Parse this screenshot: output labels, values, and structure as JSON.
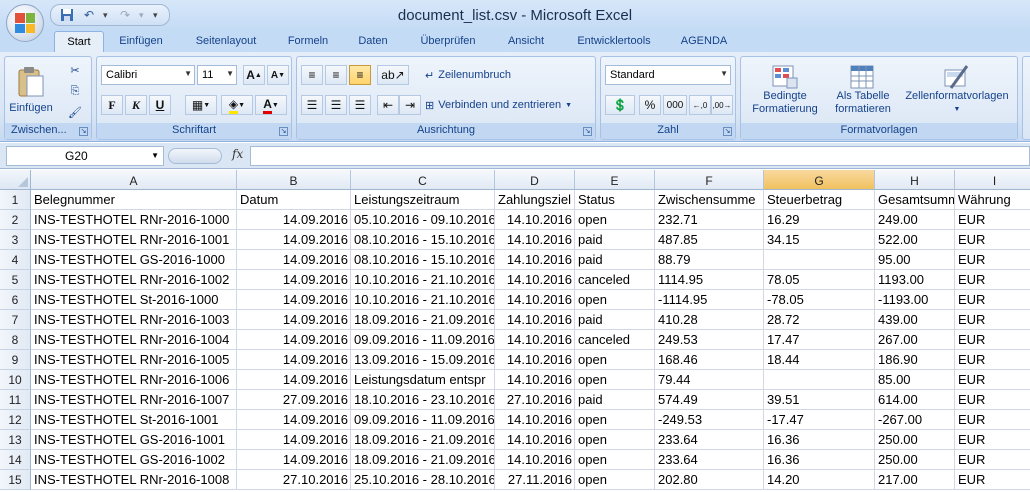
{
  "window": {
    "title": "document_list.csv - Microsoft Excel"
  },
  "tabs": [
    "Start",
    "Einfügen",
    "Seitenlayout",
    "Formeln",
    "Daten",
    "Überprüfen",
    "Ansicht",
    "Entwicklertools",
    "AGENDA"
  ],
  "ribbon": {
    "clipboard": {
      "paste_label": "Einfügen",
      "group_label": "Zwischen..."
    },
    "font": {
      "name": "Calibri",
      "size": "11",
      "bold": "F",
      "italic": "K",
      "underline": "U",
      "group_label": "Schriftart"
    },
    "alignment": {
      "wrap_label": "Zeilenumbruch",
      "merge_label": "Verbinden und zentrieren",
      "group_label": "Ausrichtung"
    },
    "number": {
      "format": "Standard",
      "percent": "%",
      "thousands": "000",
      "group_label": "Zahl"
    },
    "styles": {
      "conditional_line1": "Bedingte",
      "conditional_line2": "Formatierung",
      "table_line1": "Als Tabelle",
      "table_line2": "formatieren",
      "cellstyles_label": "Zellenformatvorlagen",
      "group_label": "Formatvorlagen"
    }
  },
  "formula_bar": {
    "name_box": "G20",
    "fx": "fx",
    "value": ""
  },
  "grid": {
    "columns": [
      "A",
      "B",
      "C",
      "D",
      "E",
      "F",
      "G",
      "H",
      "I"
    ],
    "selected_column": "G",
    "row_numbers": [
      "1",
      "2",
      "3",
      "4",
      "5",
      "6",
      "7",
      "8",
      "9",
      "10",
      "11",
      "12",
      "13",
      "14",
      "15"
    ],
    "rows": [
      [
        "Belegnummer",
        "Datum",
        "Leistungszeitraum",
        "Zahlungsziel",
        "Status",
        "Zwischensumme",
        "Steuerbetrag",
        "Gesamtsumme",
        "Währung"
      ],
      [
        "INS-TESTHOTEL RNr-2016-1000",
        "14.09.2016",
        "05.10.2016 - 09.10.2016",
        "14.10.2016",
        "open",
        "232.71",
        "16.29",
        "249.00",
        "EUR"
      ],
      [
        "INS-TESTHOTEL RNr-2016-1001",
        "14.09.2016",
        "08.10.2016 - 15.10.2016",
        "14.10.2016",
        "paid",
        "487.85",
        "34.15",
        "522.00",
        "EUR"
      ],
      [
        "INS-TESTHOTEL GS-2016-1000",
        "14.09.2016",
        "08.10.2016 - 15.10.2016",
        "14.10.2016",
        "paid",
        "88.79",
        "",
        "95.00",
        "EUR"
      ],
      [
        "INS-TESTHOTEL RNr-2016-1002",
        "14.09.2016",
        "10.10.2016 - 21.10.2016",
        "14.10.2016",
        "canceled",
        "1114.95",
        "78.05",
        "1193.00",
        "EUR"
      ],
      [
        "INS-TESTHOTEL St-2016-1000",
        "14.09.2016",
        "10.10.2016 - 21.10.2016",
        "14.10.2016",
        "open",
        "-1114.95",
        "-78.05",
        "-1193.00",
        "EUR"
      ],
      [
        "INS-TESTHOTEL RNr-2016-1003",
        "14.09.2016",
        "18.09.2016 - 21.09.2016",
        "14.10.2016",
        "paid",
        "410.28",
        "28.72",
        "439.00",
        "EUR"
      ],
      [
        "INS-TESTHOTEL RNr-2016-1004",
        "14.09.2016",
        "09.09.2016 - 11.09.2016",
        "14.10.2016",
        "canceled",
        "249.53",
        "17.47",
        "267.00",
        "EUR"
      ],
      [
        "INS-TESTHOTEL RNr-2016-1005",
        "14.09.2016",
        "13.09.2016 - 15.09.2016",
        "14.10.2016",
        "open",
        "168.46",
        "18.44",
        "186.90",
        "EUR"
      ],
      [
        "INS-TESTHOTEL RNr-2016-1006",
        "14.09.2016",
        "Leistungsdatum entspr",
        "14.10.2016",
        "open",
        "79.44",
        "",
        "85.00",
        "EUR"
      ],
      [
        "INS-TESTHOTEL RNr-2016-1007",
        "27.09.2016",
        "18.10.2016 - 23.10.2016",
        "27.10.2016",
        "paid",
        "574.49",
        "39.51",
        "614.00",
        "EUR"
      ],
      [
        "INS-TESTHOTEL St-2016-1001",
        "14.09.2016",
        "09.09.2016 - 11.09.2016",
        "14.10.2016",
        "open",
        "-249.53",
        "-17.47",
        "-267.00",
        "EUR"
      ],
      [
        "INS-TESTHOTEL GS-2016-1001",
        "14.09.2016",
        "18.09.2016 - 21.09.2016",
        "14.10.2016",
        "open",
        "233.64",
        "16.36",
        "250.00",
        "EUR"
      ],
      [
        "INS-TESTHOTEL GS-2016-1002",
        "14.09.2016",
        "18.09.2016 - 21.09.2016",
        "14.10.2016",
        "open",
        "233.64",
        "16.36",
        "250.00",
        "EUR"
      ],
      [
        "INS-TESTHOTEL RNr-2016-1008",
        "27.10.2016",
        "25.10.2016 - 28.10.2016",
        "27.11.2016",
        "open",
        "202.80",
        "14.20",
        "217.00",
        "EUR"
      ]
    ]
  }
}
